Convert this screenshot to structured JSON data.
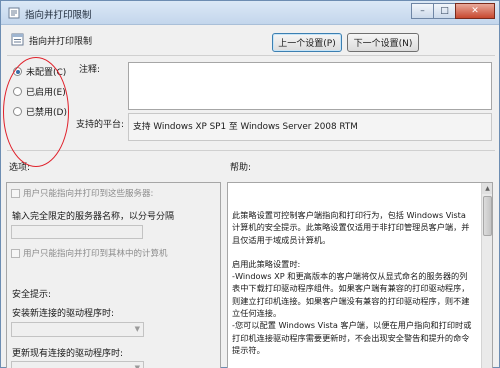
{
  "window": {
    "title": "指向并打印限制",
    "controls": {
      "minimize": "–",
      "maximize": "□",
      "close": "✕"
    }
  },
  "header": {
    "policy_name": "指向并打印限制",
    "prev_button": "上一个设置(P)",
    "next_button": "下一个设置(N)"
  },
  "state": {
    "options": [
      {
        "label": "未配置(C)",
        "checked": true
      },
      {
        "label": "已启用(E)",
        "checked": false
      },
      {
        "label": "已禁用(D)",
        "checked": false
      }
    ]
  },
  "comment": {
    "label": "注释:",
    "value": ""
  },
  "platform": {
    "label": "支持的平台:",
    "value": "支持 Windows XP SP1 至 Windows Server 2008 RTM"
  },
  "options_panel": {
    "heading": "选项:",
    "checkbox1": "用户只能指向并打印到这些服务器:",
    "server_field_label": "输入完全限定的服务器名称，以分号分隔",
    "checkbox2": "用户只能指向并打印到其林中的计算机",
    "security_heading": "安全提示:",
    "new_driver_label": "安装新连接的驱动程序时:",
    "update_driver_label": "更新现有连接的驱动程序时:"
  },
  "help_panel": {
    "heading": "帮助:",
    "paragraphs": [
      "此策略设置可控制客户端指向和打印行为，包括 Windows Vista 计算机的安全提示。此策略设置仅适用于非打印管理员客户端，并且仅适用于域成员计算机。",
      "启用此策略设置时:\n-Windows XP 和更高版本的客户端将仅从显式命名的服务器的列表中下载打印驱动程序组件。如果客户端有兼容的打印驱动程序，则建立打印机连接。如果客户端没有兼容的打印驱动程序，则不建立任何连接。\n-您可以配置 Windows Vista 客户端，以便在用户指向和打印时或打印机连接驱动程序需要更新时，不会出现安全警告和提升的命令提示符。"
    ]
  }
}
